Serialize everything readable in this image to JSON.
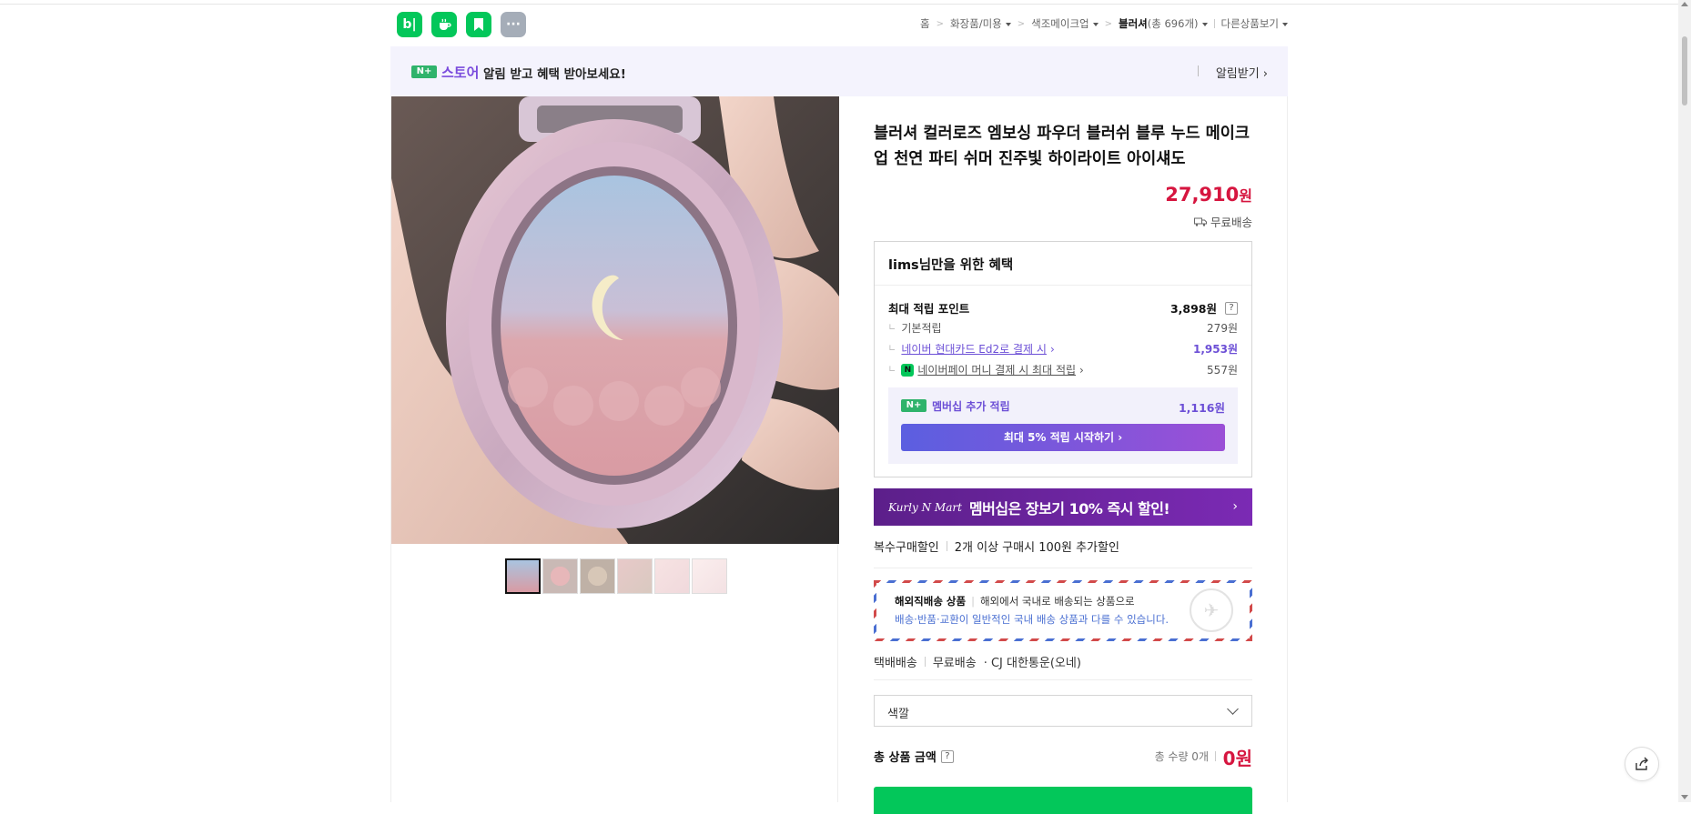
{
  "app_icons": [
    {
      "name": "blog-icon",
      "glyph": "b|"
    },
    {
      "name": "cafe-icon",
      "glyph": "☕"
    },
    {
      "name": "bookmark-icon",
      "glyph": "🔖"
    },
    {
      "name": "more-icon",
      "glyph": "···"
    }
  ],
  "breadcrumb": {
    "home": "홈",
    "cat1": "화장품/미용",
    "cat2": "색조메이크업",
    "cat3": "블러셔",
    "cat3_count": "(총 696개)",
    "other": "다른상품보기"
  },
  "banner": {
    "badge": "N+",
    "store": "스토어",
    "message": "알림 받고 혜택 받아보세요!",
    "alarm": "알림받기 ›"
  },
  "product": {
    "title": "블러셔 컬러로즈 엠보싱 파우더 블러쉬 블루 누드 메이크업 천연 파티 쉬머 진주빛 하이라이트 아이섀도",
    "price": "27,910",
    "price_unit": "원",
    "shipping": "무료배송"
  },
  "benefit": {
    "header_user": "lims",
    "header_suffix": "님만을 위한 혜택",
    "max_points_label": "최대 적립 포인트",
    "max_points_value": "3,898원",
    "qmark": "?",
    "basic_label": "기본적립",
    "basic_value": "279원",
    "card_label": "네이버 현대카드 Ed2로 결제 시",
    "card_value": "1,953원",
    "npay_label": "네이버페이 머니 결제 시 최대 적립",
    "npay_value": "557원",
    "membership_label": "멤버십 추가 적립",
    "membership_value": "1,116원",
    "membership_btn": "최대 5% 적립 시작하기 ›"
  },
  "kurly": {
    "logo": "Kurly N Mart",
    "text": "멤버십은 장보기 10% 즉시 할인!",
    "arrow": "›"
  },
  "multi_buy": {
    "label": "복수구매할인",
    "desc": "2개 이상 구매시 100원 추가할인"
  },
  "overseas": {
    "title": "해외직배송 상품",
    "line1": "해외에서 국내로 배송되는 상품으로",
    "line2": "배송·반품·교환이 일반적인 국내 배송 상품과 다를 수 있습니다."
  },
  "delivery": {
    "method": "택배배송",
    "fee": "무료배송",
    "carrier": "· CJ 대한통운(오네)"
  },
  "option_select": {
    "placeholder": "색깔"
  },
  "total": {
    "label": "총 상품 금액",
    "qmark": "?",
    "qty": "총 수량 0개",
    "amount": "0원"
  },
  "colors": {
    "accent_green": "#03c75a",
    "price_red": "#d6153f",
    "purple": "#6c4fd6"
  }
}
